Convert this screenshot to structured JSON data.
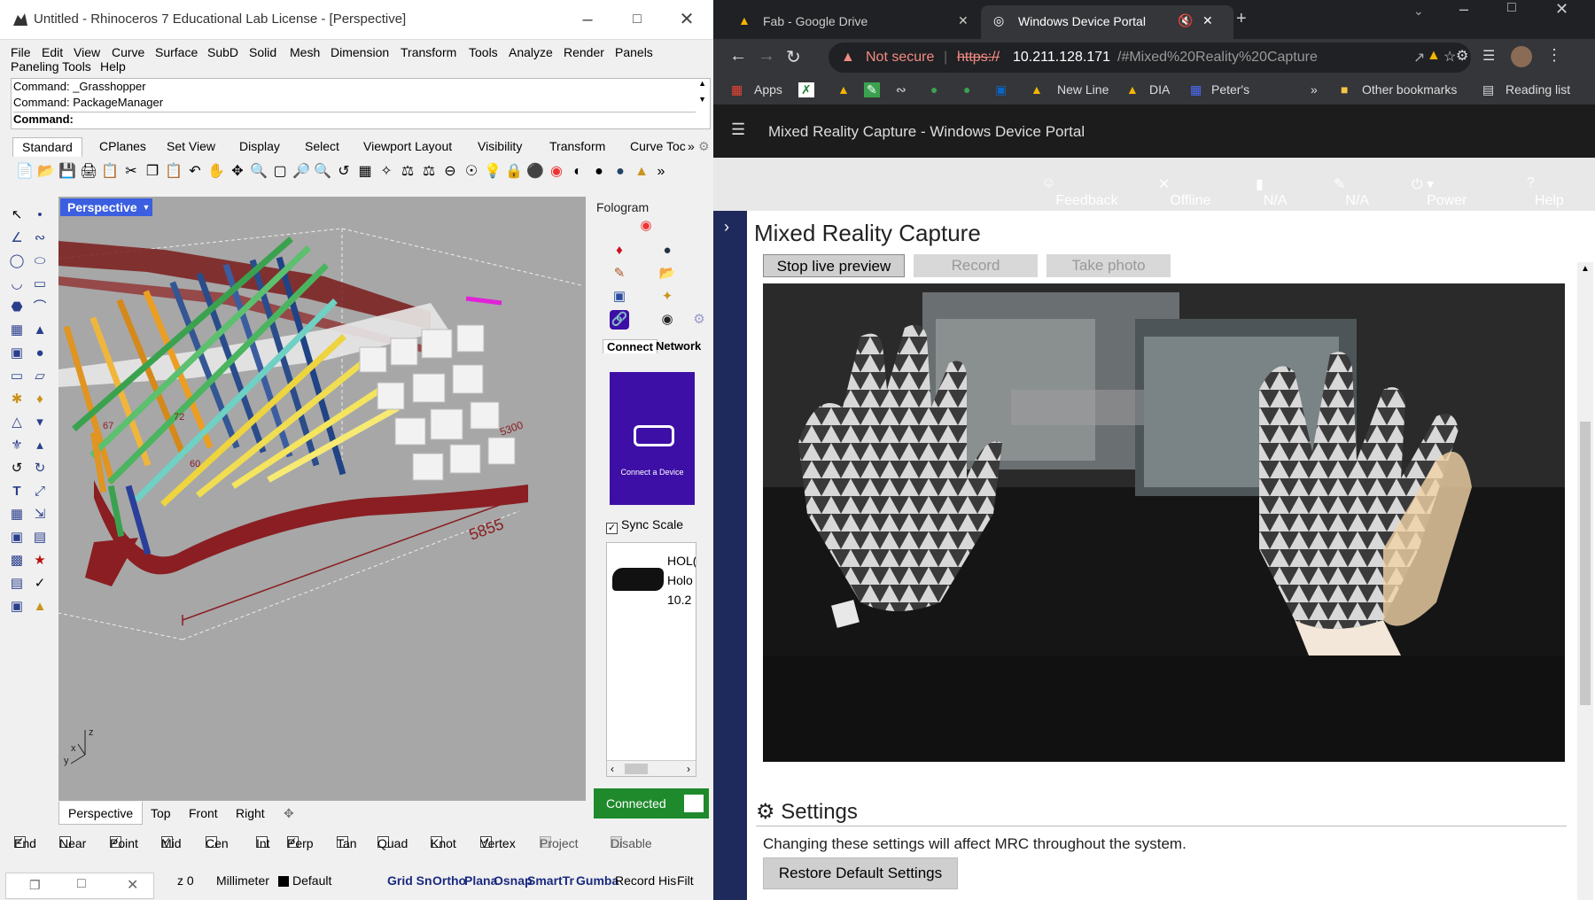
{
  "rhino": {
    "title": "Untitled - Rhinoceros 7 Educational Lab License - [Perspective]",
    "menu": [
      "File",
      "Edit",
      "View",
      "Curve",
      "Surface",
      "SubD",
      "Solid",
      "Mesh",
      "Dimension",
      "Transform",
      "Tools",
      "Analyze",
      "Render",
      "Panels"
    ],
    "menu2": [
      "Paneling Tools",
      "Help"
    ],
    "command_history": [
      "Command: _Grasshopper",
      "Command: PackageManager"
    ],
    "command_prompt": "Command:",
    "toolbar_tabs": [
      "Standard",
      "CPlanes",
      "Set View",
      "Display",
      "Select",
      "Viewport Layout",
      "Visibility",
      "Transform",
      "Curve Toc"
    ],
    "viewport_name": "Perspective",
    "dimension_labels": [
      "5855",
      "5300",
      "67",
      "72",
      "60"
    ],
    "viewport_tabs": [
      "Perspective",
      "Top",
      "Front",
      "Right"
    ],
    "fologram": {
      "title": "Fologram",
      "tabs": [
        "Connect",
        "Network"
      ],
      "device_card_label": "Connect a Device",
      "sync_scale_label": "Sync Scale",
      "sync_scale_checked": true,
      "device_lines": [
        "HOL(",
        "Holo",
        "10.2"
      ],
      "status": "Connected"
    },
    "osnaps": [
      {
        "label": "End",
        "checked": true
      },
      {
        "label": "Near",
        "checked": false
      },
      {
        "label": "Point",
        "checked": true
      },
      {
        "label": "Mid",
        "checked": true
      },
      {
        "label": "Cen",
        "checked": false
      },
      {
        "label": "Int",
        "checked": false
      },
      {
        "label": "Perp",
        "checked": true
      },
      {
        "label": "Tan",
        "checked": false
      },
      {
        "label": "Quad",
        "checked": false
      },
      {
        "label": "Knot",
        "checked": false
      },
      {
        "label": "Vertex",
        "checked": true
      },
      {
        "label": "Project",
        "checked": false
      },
      {
        "label": "Disable",
        "checked": false
      }
    ],
    "statusbar": {
      "z": "z 0",
      "units": "Millimeter",
      "layer": "Default",
      "toggles": [
        "Grid Sn",
        "Ortho",
        "Plana",
        "Osnap",
        "SmartTr",
        "Gumba",
        "Record His",
        "Filt"
      ]
    }
  },
  "browser": {
    "tabs": [
      {
        "title": "Fab - Google Drive",
        "active": false
      },
      {
        "title": "Windows Device Portal",
        "active": true
      }
    ],
    "security_label": "Not secure",
    "url_scheme": "https://",
    "url_host": "10.211.128.171",
    "url_rest": "/#Mixed%20Reality%20Capture",
    "bookmarks": [
      "Apps",
      "New Line",
      "DIA",
      "Peter's",
      "Other bookmarks",
      "Reading list"
    ],
    "wdp": {
      "header_title": "Mixed Reality Capture - Windows Device Portal",
      "top_items": [
        "Feedback",
        "Offline",
        "N/A",
        "N/A",
        "Power",
        "Help"
      ],
      "page_title": "Mixed Reality Capture",
      "buttons": [
        "Stop live preview",
        "Record",
        "Take photo"
      ],
      "settings_title": "Settings",
      "settings_desc": "Changing these settings will affect MRC throughout the system.",
      "restore_button": "Restore Default Settings"
    }
  },
  "colors": {
    "viewport_bg": "#a7a7a7",
    "perspective_label": "#3b5fe0",
    "fologram_card": "#3d0fa6",
    "connected": "#1e8a2c",
    "browser_dark": "#202124",
    "wdp_header": "#1c1c1c",
    "wdp_sidebar": "#1e2a5c"
  }
}
